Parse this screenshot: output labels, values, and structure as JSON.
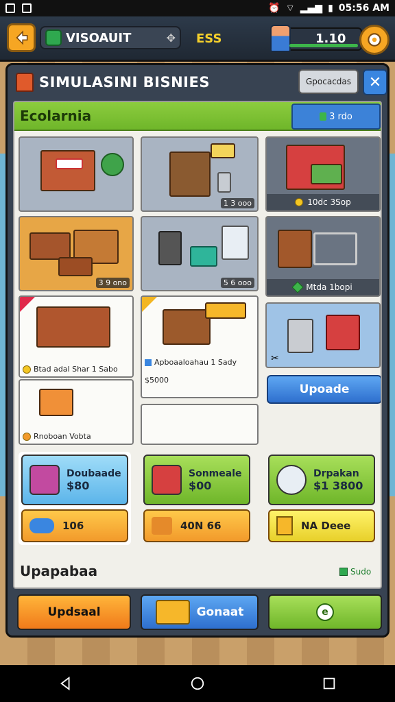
{
  "status_bar": {
    "time": "05:56 AM",
    "icons": [
      "notification-icon",
      "gallery-icon",
      "alarm-icon",
      "wifi-icon",
      "signal-icon",
      "battery-icon"
    ]
  },
  "hud": {
    "player_name": "VISOAUIT",
    "coins": "ESS",
    "level": "1.10",
    "level_progress": 0.8
  },
  "panel": {
    "title": "SIMULASINI BISNIES",
    "filter_label": "Gpocacdas",
    "close_label": "✕",
    "category": "Ecolarnia",
    "category_price": "3 rdo"
  },
  "tiles": [
    {
      "name": "storefront",
      "price": ""
    },
    {
      "name": "shelf-display",
      "price": "1 3 ooo"
    },
    {
      "name": "bisney-stand",
      "label": "10dc 3Sop"
    },
    {
      "name": "wood-counters",
      "price": "3 9 ono"
    },
    {
      "name": "appliances",
      "price": "5 6 ooo"
    },
    {
      "name": "cart-shelf",
      "label": "Mtda 1bopi"
    },
    {
      "name": "wagon",
      "label": "Btad adal Shar 1 Sabo"
    },
    {
      "name": "produce-stand",
      "label": "Apboaaloahau 1 Sady",
      "sub": "$5000"
    },
    {
      "name": "appliance-cart",
      "label": ""
    },
    {
      "name": "basket",
      "label": "Rnoboan Vobta"
    },
    {
      "name": "empty",
      "label": ""
    }
  ],
  "upgrade_label": "Upoade",
  "cards": [
    {
      "title": "Doubaade",
      "price": "$80",
      "bottom": "106",
      "color": "#79c8f4"
    },
    {
      "title": "Sonmeale",
      "price": "$00",
      "bottom": "40N 66",
      "color": "#86c93b"
    },
    {
      "title": "Drpakan",
      "price": "$1 3800",
      "bottom": "NA Deee",
      "color": "#86c93b"
    }
  ],
  "footer": {
    "label": "Upapabaa",
    "right": "Sudo"
  },
  "bottom_buttons": {
    "left": "Updsaal",
    "middle": "Gonaat",
    "right": "e"
  },
  "colors": {
    "orange_btn": "#f6a623",
    "blue_btn": "#3a86e0",
    "green_btn": "#86c93b"
  }
}
